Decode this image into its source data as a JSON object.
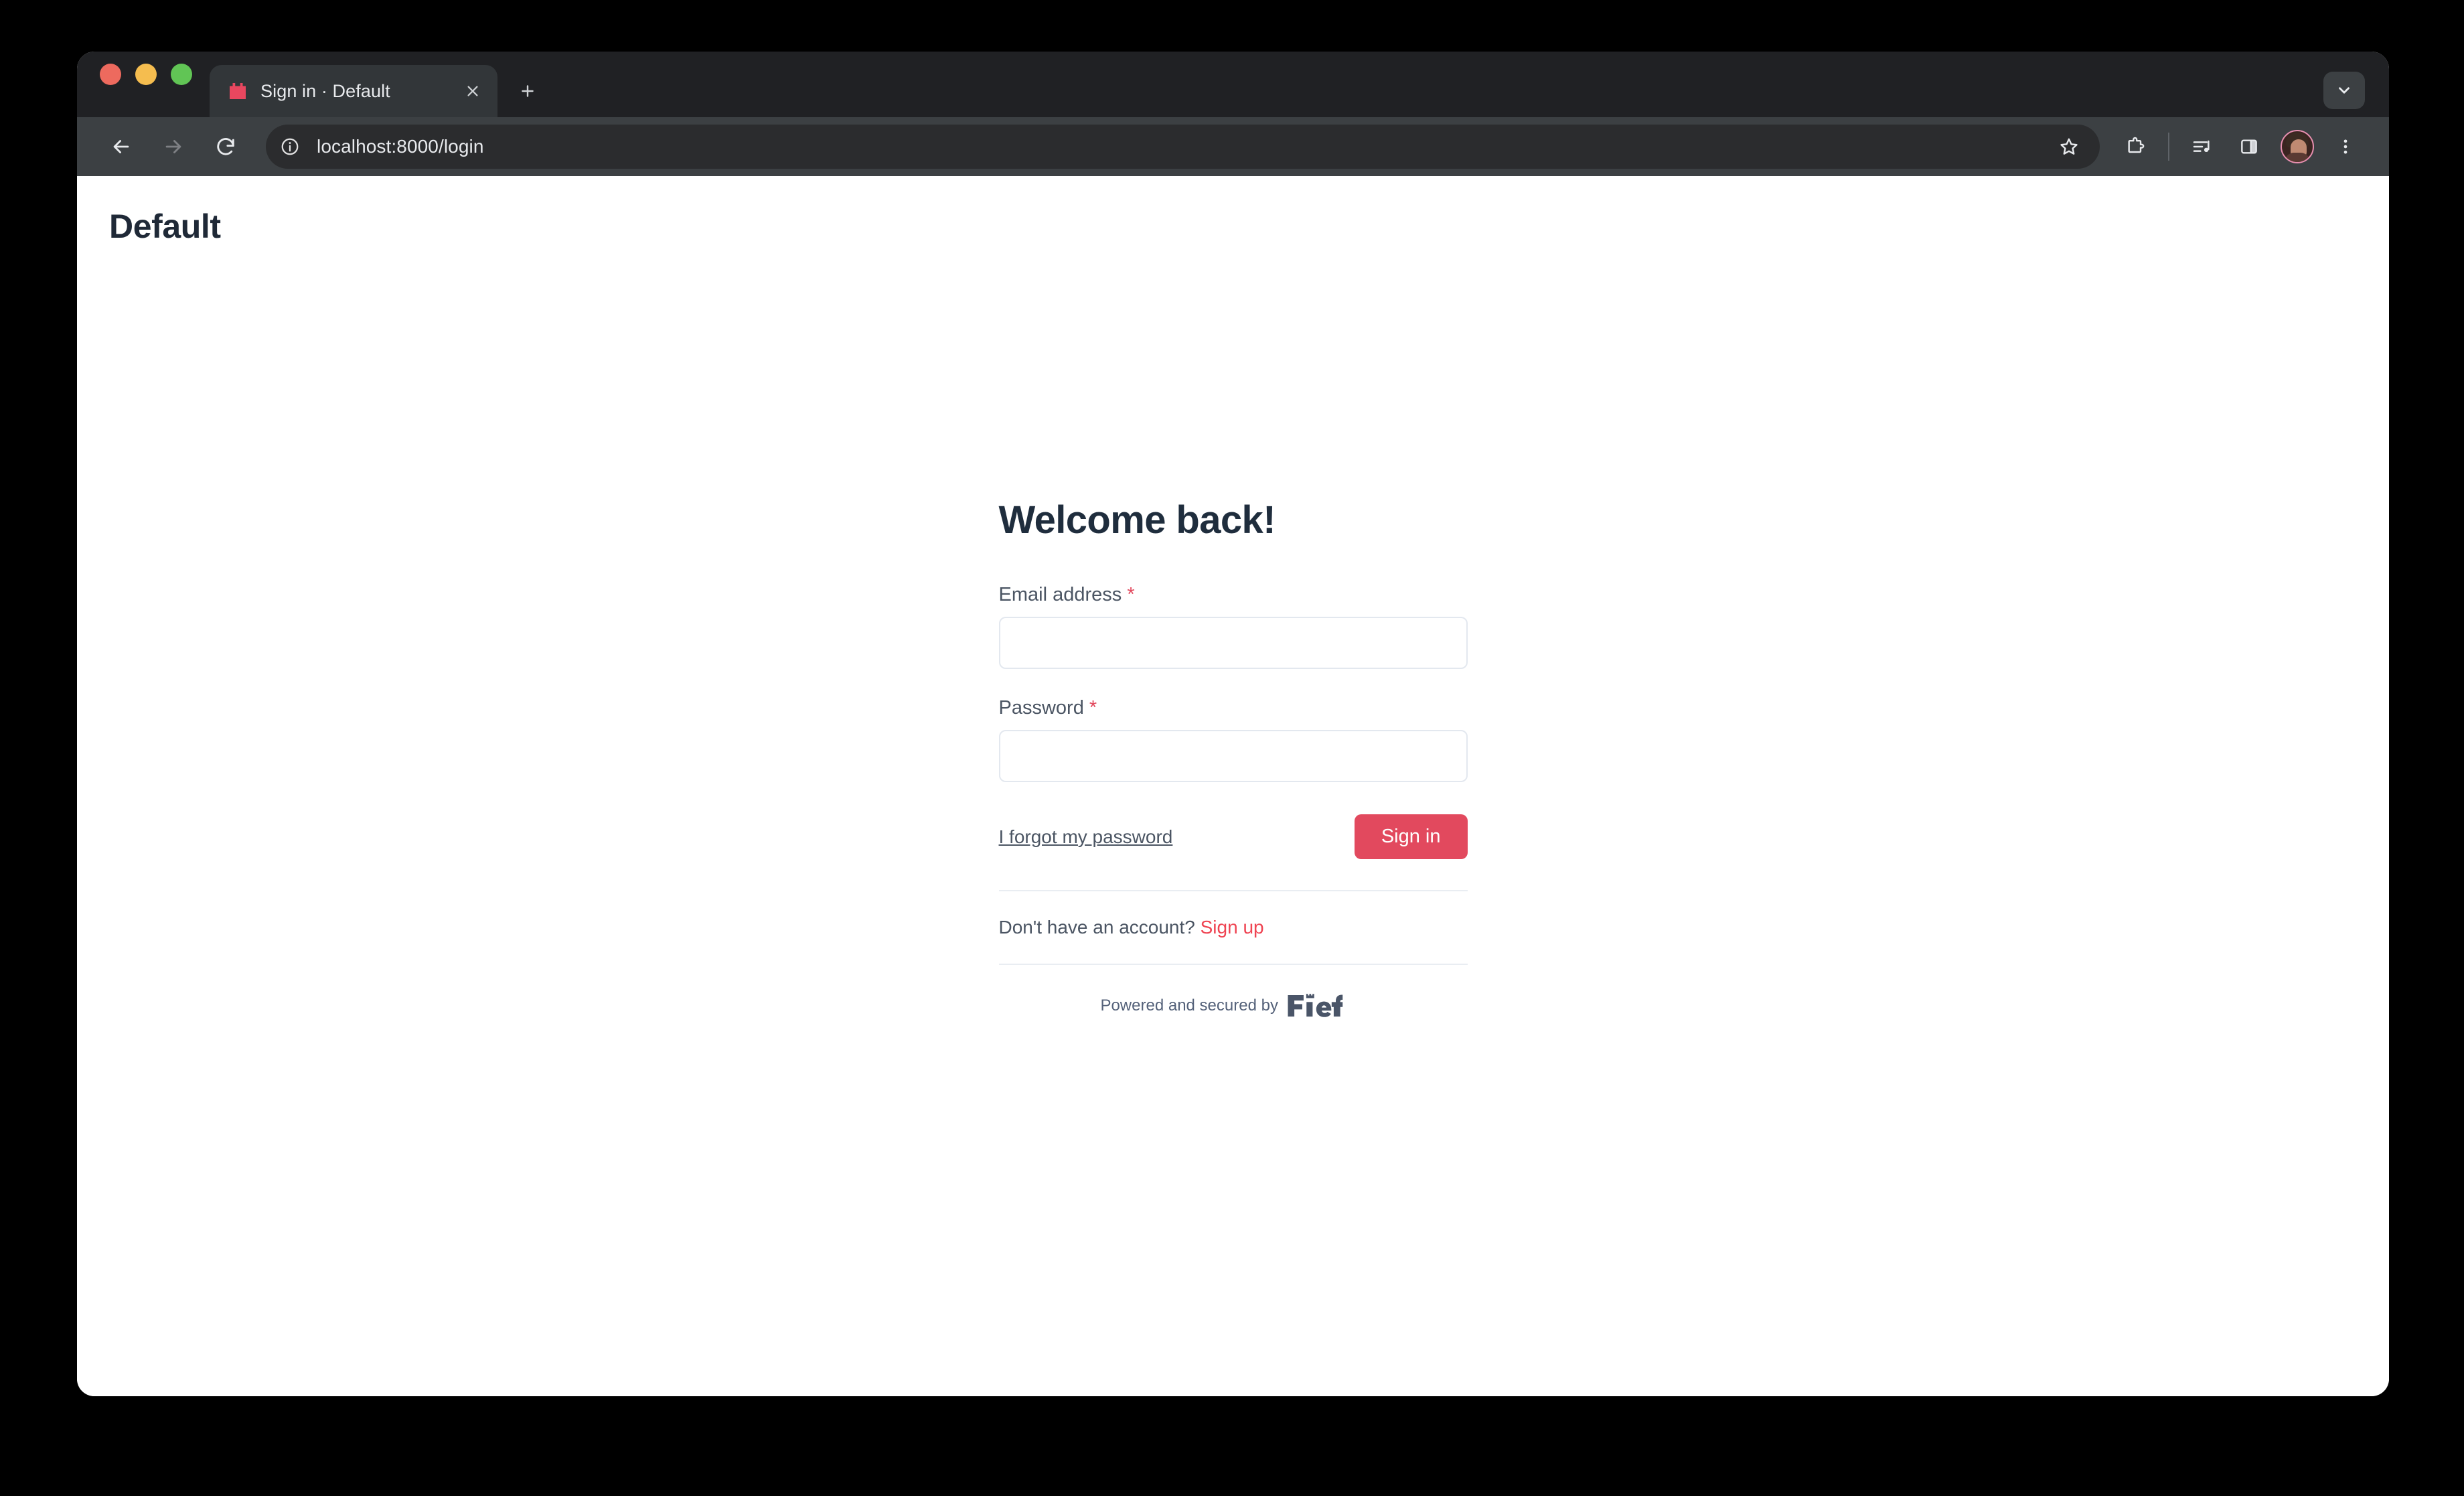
{
  "browser": {
    "traffic_lights": [
      "close",
      "minimize",
      "zoom"
    ],
    "tab": {
      "title": "Sign in · Default",
      "favicon": "fief-castle-icon",
      "close_label": "Close tab"
    },
    "new_tab_label": "New Tab",
    "tab_search_label": "Search tabs",
    "toolbar": {
      "back_label": "Back",
      "forward_label": "Forward",
      "reload_label": "Reload",
      "site_info_label": "View site information",
      "url": "localhost:8000/login",
      "bookmark_label": "Bookmark this tab",
      "extensions_label": "Extensions",
      "media_label": "Media controls",
      "side_panel_label": "Side panel",
      "profile_label": "Profile",
      "menu_label": "Customize and control Chrome"
    }
  },
  "page": {
    "site_title": "Default",
    "heading": "Welcome back!",
    "fields": [
      {
        "name": "email",
        "label": "Email address",
        "required_mark": "*",
        "value": "",
        "placeholder": "",
        "type": "email"
      },
      {
        "name": "password",
        "label": "Password",
        "required_mark": "*",
        "value": "",
        "placeholder": "",
        "type": "password"
      }
    ],
    "forgot_password_label": "I forgot my password",
    "signin_button_label": "Sign in",
    "signup_prompt": "Don't have an account?",
    "signup_link_label": "Sign up",
    "powered_text": "Powered and secured by",
    "powered_brand": "Fief"
  },
  "colors": {
    "accent": "#e2495e",
    "signup_link": "#ef4452",
    "heading": "#1f2d3d",
    "label": "#4b5563",
    "input_border": "#e3e8ef",
    "divider": "#e9edf2",
    "browser_tabstrip": "#202124",
    "browser_toolbar": "#3c4043",
    "page_background": "#ffffff"
  }
}
